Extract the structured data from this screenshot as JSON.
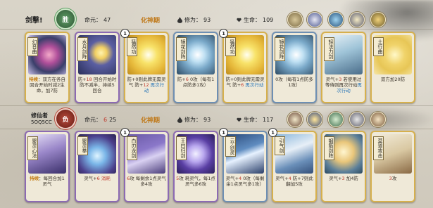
{
  "player1": {
    "name": "剑撃!",
    "result_badge": "胜",
    "mingyuan_label": "命元：",
    "mingyuan": "47",
    "realm": "化神期",
    "xiuwei_label": "修为：",
    "xiuwei": "93",
    "life_label": "生命：",
    "life": "109",
    "cards": [
      {
        "title": "幻音曲",
        "level": "",
        "border": "gold",
        "art": "lotus",
        "lines": [
          {
            "t": "持续",
            "c": "t-orange t-bold"
          },
          {
            "t": "：双方在各自回合开始时减2生命，加7防",
            "c": ""
          }
        ]
      },
      {
        "title": "水月剑阵",
        "level": "",
        "border": "purple",
        "art": "moon",
        "lines": [
          {
            "t": "防+",
            "c": ""
          },
          {
            "t": "18",
            "c": "t-red"
          },
          {
            "t": " 回合开始时防不减半，持续5回合",
            "c": ""
          }
        ]
      },
      {
        "title": "猛然功",
        "level": "1",
        "border": "gold",
        "art": "glow",
        "lines": [
          {
            "t": "防+0则此牌无需灵气",
            "c": ""
          },
          {
            "t": " 防+",
            "c": ""
          },
          {
            "t": "12",
            "c": "t-red"
          },
          {
            "t": " 再次行动",
            "c": "t-blue"
          }
        ]
      },
      {
        "title": "镜花剑阵",
        "level": "",
        "border": "blue",
        "art": "circle",
        "lines": [
          {
            "t": "防+",
            "c": ""
          },
          {
            "t": "6",
            "c": "t-red"
          },
          {
            "t": " 0攻（每有1点防多1攻）",
            "c": ""
          }
        ]
      },
      {
        "title": "猛然功",
        "level": "1",
        "border": "gold",
        "art": "glow",
        "lines": [
          {
            "t": "防+0则此牌无需灵气",
            "c": ""
          },
          {
            "t": " 防+",
            "c": ""
          },
          {
            "t": "6",
            "c": "t-red"
          },
          {
            "t": " 再次行动",
            "c": "t-blue"
          }
        ]
      },
      {
        "title": "镜花剑阵",
        "level": "",
        "border": "blue",
        "art": "circle",
        "lines": [
          {
            "t": "0攻（每有1点防多1攻）",
            "c": ""
          }
        ]
      },
      {
        "title": "轻法力剑",
        "level": "",
        "border": "gold",
        "art": "sage",
        "lines": [
          {
            "t": "灵气+",
            "c": ""
          },
          {
            "t": "3",
            "c": "t-red"
          },
          {
            "t": " 若使用过等待则再次行动",
            "c": ""
          },
          {
            "t": "再次行动",
            "c": "t-blue"
          }
        ]
      },
      {
        "title": "土行曲",
        "level": "",
        "border": "gold",
        "art": "earth",
        "lines": [
          {
            "t": "双方加20防",
            "c": ""
          }
        ]
      }
    ]
  },
  "player2": {
    "name": "修仙者",
    "sub": "5OQ5CC",
    "result_badge": "负",
    "mingyuan_label": "命元：",
    "mingyuan_a": "6",
    "mingyuan_b": "25",
    "realm": "化神期",
    "xiuwei_label": "修为：",
    "xiuwei": "93",
    "life_label": "生命：",
    "life": "117",
    "cards": [
      {
        "title": "聚灵心法",
        "level": "",
        "border": "purple",
        "art": "meditate",
        "lines": [
          {
            "t": "持续",
            "c": "t-orange t-bold"
          },
          {
            "t": "：每回合加1灵气",
            "c": ""
          }
        ]
      },
      {
        "title": "聚灵拳",
        "level": "",
        "border": "purple",
        "art": "punch",
        "lines": [
          {
            "t": "灵气+",
            "c": ""
          },
          {
            "t": "6",
            "c": "t-red"
          },
          {
            "t": " 消耗",
            "c": "t-red"
          }
        ]
      },
      {
        "title": "白刃龙剑",
        "level": "1",
        "border": "purple",
        "art": "dragon",
        "lines": [
          {
            "t": "6",
            "c": "t-red"
          },
          {
            "t": "攻 每剩余1点灵气多4攻",
            "c": ""
          }
        ]
      },
      {
        "title": "王曰归剑",
        "level": "",
        "border": "purple",
        "art": "lightning",
        "lines": [
          {
            "t": "5",
            "c": "t-red"
          },
          {
            "t": "攻 耗灵气，每1点灵气多6攻",
            "c": ""
          }
        ]
      },
      {
        "title": "云·剑灵",
        "level": "1",
        "border": "blue",
        "art": "sword",
        "lines": [
          {
            "t": "灵气+",
            "c": ""
          },
          {
            "t": "4",
            "c": "t-red"
          },
          {
            "t": " 0攻（每剩余1点灵气多1攻）",
            "c": ""
          }
        ]
      },
      {
        "title": "引气剑",
        "level": "1",
        "border": "gold",
        "art": "boy",
        "lines": [
          {
            "t": "灵气+",
            "c": ""
          },
          {
            "t": "4",
            "c": "t-red"
          },
          {
            "t": " 防+7则此翻加5攻",
            "c": ""
          }
        ]
      },
      {
        "title": "钢筋剑阵",
        "level": "",
        "border": "gold",
        "art": "weapons",
        "lines": [
          {
            "t": "灵气+",
            "c": ""
          },
          {
            "t": "3",
            "c": "t-red"
          },
          {
            "t": " 加4防",
            "c": ""
          }
        ]
      },
      {
        "title": "莫道攻击",
        "level": "",
        "border": "gold",
        "art": "warrior",
        "lines": [
          {
            "t": "3",
            "c": "t-red"
          },
          {
            "t": "攻",
            "c": ""
          }
        ]
      }
    ]
  },
  "colors": {
    "realm": "#c07a1b",
    "win": "#5f9e66",
    "lose": "#b84b3c"
  }
}
